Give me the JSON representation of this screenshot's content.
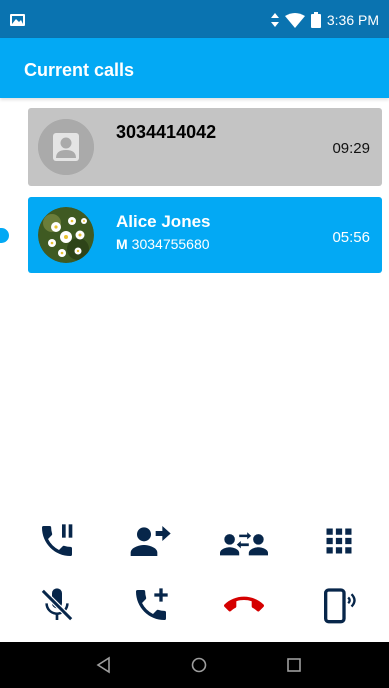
{
  "status_bar": {
    "time": "3:36 PM",
    "icons": [
      "photo-icon",
      "data-arrows-icon",
      "wifi-icon",
      "battery-icon"
    ]
  },
  "header": {
    "title": "Current calls"
  },
  "calls": [
    {
      "name": "3034414042",
      "duration": "09:29",
      "state": "on-hold",
      "avatar": "default-contact-icon"
    },
    {
      "name": "Alice Jones",
      "number_type": "M",
      "number": "3034755680",
      "duration": "05:56",
      "state": "active",
      "avatar": "daisy-photo"
    }
  ],
  "actions": [
    {
      "name": "hold-call",
      "icon": "phone-pause-icon"
    },
    {
      "name": "transfer-call",
      "icon": "person-arrow-icon"
    },
    {
      "name": "swap-calls",
      "icon": "group-swap-icon"
    },
    {
      "name": "dialpad",
      "icon": "dialpad-icon"
    },
    {
      "name": "mute",
      "icon": "mic-off-icon"
    },
    {
      "name": "add-call",
      "icon": "phone-plus-icon"
    },
    {
      "name": "end-call",
      "icon": "hangup-icon"
    },
    {
      "name": "speaker",
      "icon": "phone-speaker-icon"
    }
  ],
  "colors": {
    "status_bar": "#0a73b0",
    "header": "#03a9f4",
    "active_card": "#03a9f4",
    "held_card": "#c4c4c4",
    "icon": "#07264a",
    "hangup": "#d50000"
  },
  "nav": [
    "back-icon",
    "home-icon",
    "recents-icon"
  ]
}
